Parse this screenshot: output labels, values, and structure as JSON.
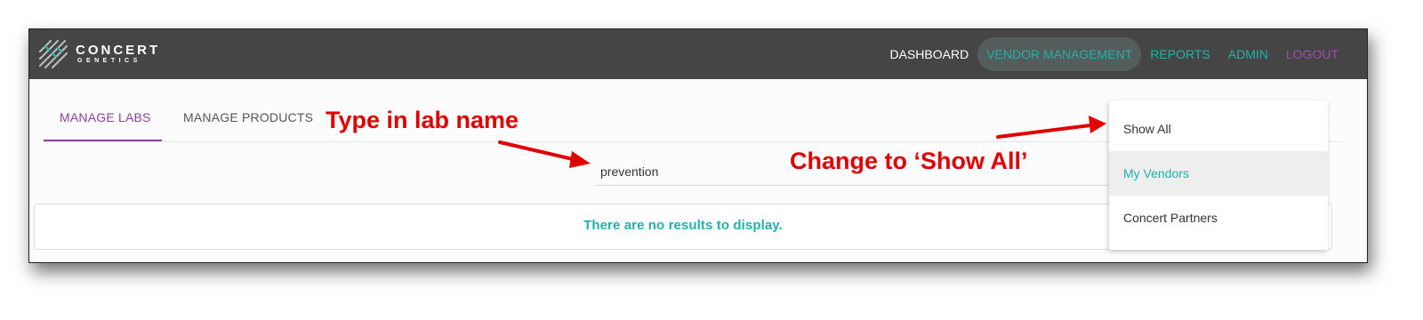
{
  "app": {
    "logo_main": "CONCERT",
    "logo_sub": "GENETICS"
  },
  "nav": {
    "items": [
      {
        "label": "DASHBOARD",
        "color": "#ffffff",
        "active": false
      },
      {
        "label": "VENDOR MANAGEMENT",
        "color": "#20b2aa",
        "active": true
      },
      {
        "label": "REPORTS",
        "color": "#20b2aa",
        "active": false
      },
      {
        "label": "ADMIN",
        "color": "#20b2aa",
        "active": false
      },
      {
        "label": "LOGOUT",
        "color": "#9b4fae",
        "active": false
      }
    ]
  },
  "tabs": [
    {
      "label": "MANAGE LABS",
      "active": true
    },
    {
      "label": "MANAGE PRODUCTS",
      "active": false
    }
  ],
  "search": {
    "value": "prevention"
  },
  "results": {
    "message": "There are no results to display."
  },
  "filter_dropdown": {
    "options": [
      "Show All",
      "My Vendors",
      "Concert Partners"
    ],
    "selected": "My Vendors"
  },
  "annotations": {
    "type_lab_name": "Type in lab name",
    "change_show_all": "Change to ‘Show All’"
  },
  "colors": {
    "topbar": "#454545",
    "accent_teal": "#20b2aa",
    "accent_purple": "#8b3f9e",
    "annotation_red": "#e00000"
  },
  "icons": {
    "logo": "concert-genetics-logo-icon",
    "arrow": "annotation-arrow-icon"
  }
}
